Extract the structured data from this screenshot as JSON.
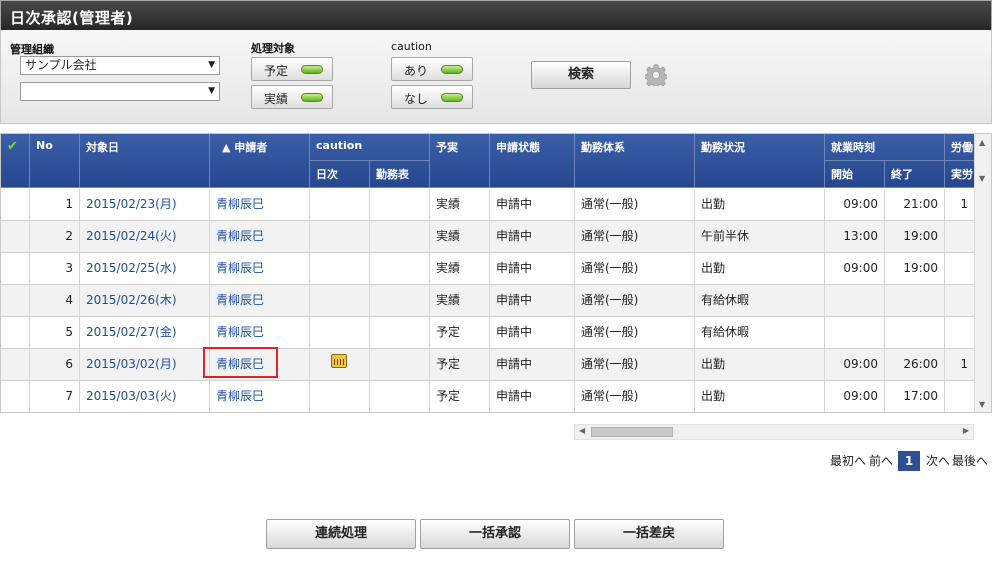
{
  "window": {
    "title": "日次承認(管理者)"
  },
  "filters": {
    "org_label": "管理組織",
    "org_value": "サンプル会社",
    "org_sub_value": "",
    "target_label": "処理対象",
    "target_plan": "予定",
    "target_actual": "実績",
    "caution_label": "caution",
    "caution_yes": "あり",
    "caution_no": "なし",
    "search_label": "検索"
  },
  "table": {
    "headers": {
      "check": "✔",
      "no": "No",
      "date": "対象日",
      "applicant": "▲ 申請者",
      "caution": "caution",
      "caution_daily": "日次",
      "caution_sheet": "勤務表",
      "plan": "予実",
      "status": "申請状態",
      "system": "勤務体系",
      "work": "勤務状況",
      "hours": "就業時刻",
      "start": "開始",
      "end": "終了",
      "labor": "労働",
      "actual": "実労"
    },
    "rows": [
      {
        "no": "1",
        "date": "2015/02/23(月)",
        "applicant": "青柳辰巳",
        "plan": "実績",
        "status": "申請中",
        "system": "通常(一般)",
        "work": "出勤",
        "start": "09:00",
        "end": "21:00",
        "extra": "1"
      },
      {
        "no": "2",
        "date": "2015/02/24(火)",
        "applicant": "青柳辰巳",
        "plan": "実績",
        "status": "申請中",
        "system": "通常(一般)",
        "work": "午前半休",
        "start": "13:00",
        "end": "19:00",
        "extra": ""
      },
      {
        "no": "3",
        "date": "2015/02/25(水)",
        "applicant": "青柳辰巳",
        "plan": "実績",
        "status": "申請中",
        "system": "通常(一般)",
        "work": "出勤",
        "start": "09:00",
        "end": "19:00",
        "extra": ""
      },
      {
        "no": "4",
        "date": "2015/02/26(木)",
        "applicant": "青柳辰巳",
        "plan": "実績",
        "status": "申請中",
        "system": "通常(一般)",
        "work": "有給休暇",
        "start": "",
        "end": "",
        "extra": ""
      },
      {
        "no": "5",
        "date": "2015/02/27(金)",
        "applicant": "青柳辰巳",
        "plan": "予定",
        "status": "申請中",
        "system": "通常(一般)",
        "work": "有給休暇",
        "start": "",
        "end": "",
        "extra": ""
      },
      {
        "no": "6",
        "date": "2015/03/02(月)",
        "applicant": "青柳辰巳",
        "plan": "予定",
        "status": "申請中",
        "system": "通常(一般)",
        "work": "出勤",
        "start": "09:00",
        "end": "26:00",
        "extra": "1"
      },
      {
        "no": "7",
        "date": "2015/03/03(火)",
        "applicant": "青柳辰巳",
        "plan": "予定",
        "status": "申請中",
        "system": "通常(一般)",
        "work": "出勤",
        "start": "09:00",
        "end": "17:00",
        "extra": ""
      }
    ]
  },
  "pager": {
    "first": "最初へ",
    "prev": "前へ",
    "current": "1",
    "next": "次へ",
    "last": "最後へ"
  },
  "actions": {
    "continuous": "連続処理",
    "bulk_approve": "一括承認",
    "bulk_return": "一括差戻"
  },
  "colors": {
    "header_blue": "#2d4f93",
    "led_green": "#7ed33a",
    "highlight_red": "#d9262c",
    "link": "#1a4fa0"
  }
}
